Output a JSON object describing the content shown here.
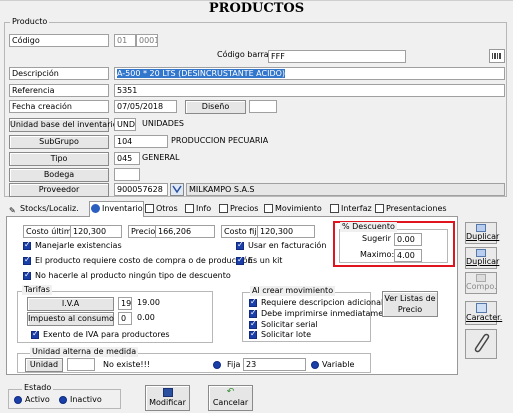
{
  "window": {
    "title": "PRODUCTOS"
  },
  "producto_group": {
    "label": "Producto"
  },
  "form": {
    "codigo": {
      "label": "Código",
      "value1": "01",
      "value2": "0001"
    },
    "codigo_barras": {
      "label": "Código barras",
      "value": "FFF"
    },
    "descripcion": {
      "label": "Descripción",
      "value": "A-500 * 20 LTS (DESINCRUSTANTE ACIDO)"
    },
    "referencia": {
      "label": "Referencia",
      "value": "5351"
    },
    "fecha_creacion": {
      "label": "Fecha creación",
      "value": "07/05/2018"
    },
    "diseno_label": "Diseño",
    "unidad_base": {
      "label": "Unidad base del inventario",
      "code": "UND",
      "name": "UNIDADES"
    },
    "subgrupo": {
      "label": "SubGrupo",
      "code": "104",
      "name": "PRODUCCION PECUARIA"
    },
    "tipo": {
      "label": "Tipo",
      "code": "045",
      "name": "GENERAL"
    },
    "bodega": {
      "label": "Bodega",
      "value": ""
    },
    "proveedor": {
      "label": "Proveedor",
      "code": "900057628",
      "name": "MILKAMPO S.A.S"
    }
  },
  "tabs": [
    {
      "label": "Stocks/Localiz."
    },
    {
      "label": "Inventario"
    },
    {
      "label": "Otros"
    },
    {
      "label": "Info"
    },
    {
      "label": "Precios"
    },
    {
      "label": "Movimiento"
    },
    {
      "label": "Interfaz"
    },
    {
      "label": "Presentaciones"
    }
  ],
  "inventario": {
    "costo_ultimo": {
      "label": "Costo último",
      "value": "120,300"
    },
    "precio": {
      "label": "Precio",
      "value": "166,206"
    },
    "costo_fijo": {
      "label": "Costo fijo",
      "value": "120,300"
    },
    "checks_left": [
      "Manejarle existencias",
      "El producto requiere costo de compra o de producción",
      "No hacerle al producto ningún tipo de descuento"
    ],
    "checks_right": [
      "Usar en facturación",
      "Es un kit"
    ],
    "descuento": {
      "title": "% Descuento",
      "sugerir_label": "Sugerir",
      "sugerir_value": "0.00",
      "maximo_label": "Maximo:",
      "maximo_value": "4.00"
    },
    "tarifas": {
      "title": "Tarifas",
      "iva_label": "I.V.A",
      "iva_code": "19",
      "iva_value": "19.00",
      "consumo_label": "Impuesto al consumo",
      "consumo_code": "0",
      "consumo_value": "0.00",
      "exento_label": "Exento de IVA para productores"
    },
    "al_crear": {
      "title": "Al crear movimiento",
      "checks": [
        "Requiere descripcion adicional",
        "Debe imprimirse inmediatamente",
        "Solicitar serial",
        "Solicitar lote"
      ]
    },
    "ver_listas": "Ver Listas de Precio",
    "unidad_alterna": {
      "title": "Unidad alterna de medida",
      "unidad_label": "Unidad",
      "unidad_value": "",
      "no_existe": "No existe!!!",
      "fija_label": "Fija",
      "fija_value": "23",
      "variable_label": "Variable"
    }
  },
  "side_buttons": [
    {
      "label": "Duplicar"
    },
    {
      "label": "Duplicar"
    },
    {
      "label": "Compo."
    },
    {
      "label": "Caracter."
    }
  ],
  "estado": {
    "title": "Estado",
    "activo": "Activo",
    "inactivo": "Inactivo"
  },
  "footer": {
    "modificar": "Modificar",
    "cancelar": "Cancelar"
  },
  "colors": {
    "highlight_box": "#e0141e",
    "selection": "#3377cc",
    "check_blue": "#1a3fa8"
  }
}
